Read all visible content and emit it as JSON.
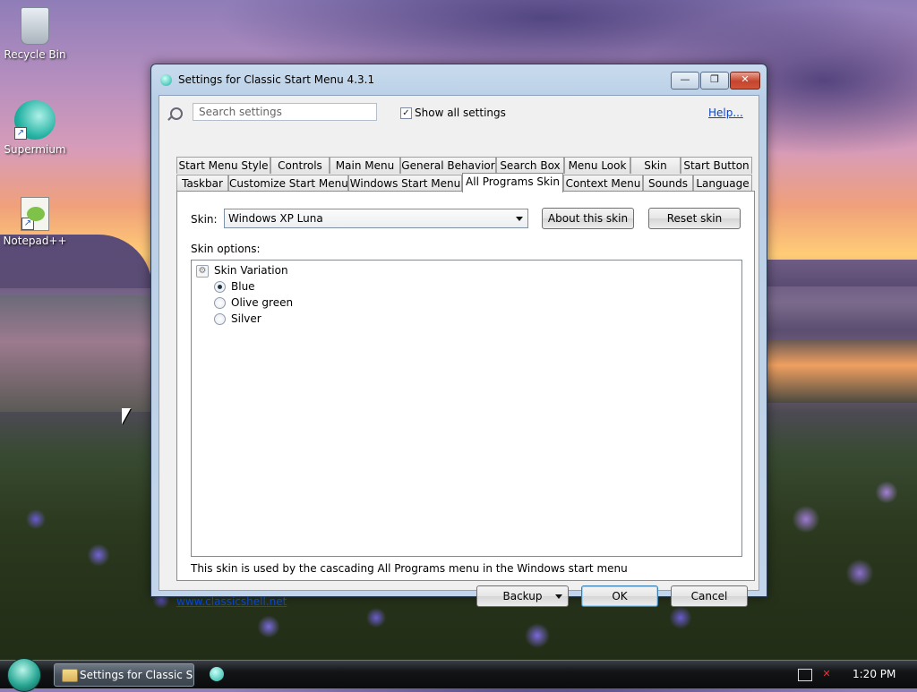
{
  "desktop": {
    "icons": [
      {
        "label": "Recycle Bin",
        "icon": "recycle-bin-icon"
      },
      {
        "label": "Supermium",
        "icon": "supermium-icon"
      },
      {
        "label": "Notepad++",
        "icon": "notepad-plus-plus-icon"
      }
    ]
  },
  "window": {
    "title": "Settings for Classic Start Menu 4.3.1",
    "controls": {
      "minimize": "—",
      "maximize": "❐",
      "close": "✕"
    }
  },
  "toolbar": {
    "search_placeholder": "Search settings",
    "show_all_label": "Show all settings",
    "show_all_checked": true,
    "help_label": "Help..."
  },
  "tabs": {
    "row1": [
      "Start Menu Style",
      "Controls",
      "Main Menu",
      "General Behavior",
      "Search Box",
      "Menu Look",
      "Skin",
      "Start Button"
    ],
    "row2": [
      "Taskbar",
      "Customize Start Menu",
      "Windows Start Menu",
      "All Programs Skin",
      "Context Menu",
      "Sounds",
      "Language"
    ],
    "active": "All Programs Skin"
  },
  "panel": {
    "skin_label": "Skin:",
    "skin_value": "Windows XP Luna",
    "about_button": "About this skin",
    "reset_button": "Reset skin",
    "options_label": "Skin options:",
    "tree": {
      "title": "Skin Variation",
      "options": [
        {
          "label": "Blue",
          "selected": true
        },
        {
          "label": "Olive green",
          "selected": false
        },
        {
          "label": "Silver",
          "selected": false
        }
      ]
    },
    "description": "This skin is used by the cascading All Programs menu in the Windows start menu"
  },
  "footer": {
    "link": "www.classicshell.net",
    "backup_button": "Backup",
    "ok_button": "OK",
    "cancel_button": "Cancel"
  },
  "taskbar": {
    "task_label": "Settings for Classic S...",
    "clock": "1:20 PM"
  }
}
